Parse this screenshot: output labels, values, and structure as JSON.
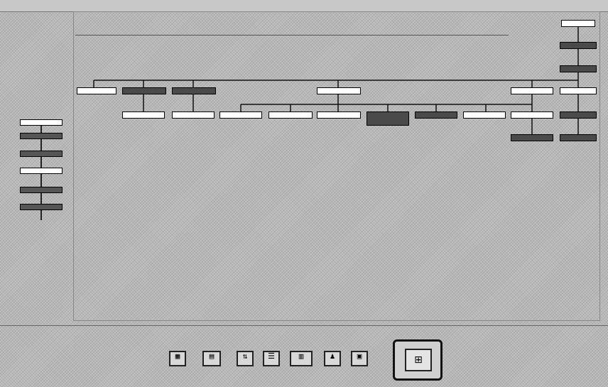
{
  "menubar": {
    "items": [
      "",
      "",
      "",
      "",
      "",
      "",
      "",
      "",
      "",
      "",
      ""
    ]
  },
  "diagram": {
    "title_node": "",
    "side_nodes": [
      "",
      "",
      "",
      "",
      "",
      ""
    ],
    "row1": [
      "",
      "",
      "",
      "",
      "",
      "",
      ""
    ],
    "row2": [
      "",
      "",
      "",
      "",
      "",
      "",
      "",
      "",
      "",
      ""
    ],
    "row3": [
      "",
      ""
    ],
    "right_column": [
      "",
      ""
    ]
  },
  "statusbar": {
    "items": [
      "",
      "",
      "",
      "",
      "",
      "",
      ""
    ]
  },
  "toolbar": {
    "buttons": [
      {
        "icon": "table-icon"
      },
      {
        "icon": "grid-icon"
      },
      {
        "icon": "sort-icon"
      },
      {
        "icon": "list-icon"
      },
      {
        "icon": "chart-icon"
      },
      {
        "icon": "person-icon"
      },
      {
        "icon": "document-icon"
      }
    ],
    "big_button_icon": "tree-icon"
  }
}
